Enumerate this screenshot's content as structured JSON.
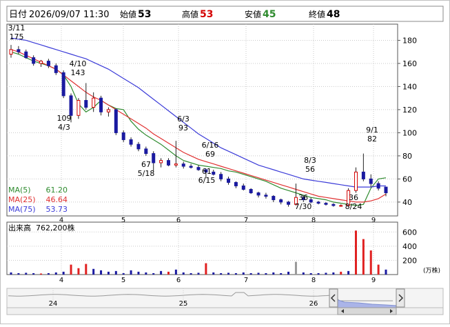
{
  "header": {
    "date_label": "日付",
    "datetime": "2026/09/07 11:30",
    "open_label": "始値",
    "open_value": "53",
    "high_label": "高値",
    "high_value": "53",
    "low_label": "安値",
    "low_value": "45",
    "close_label": "終値",
    "close_value": "48"
  },
  "colors": {
    "up": "#d40000",
    "down": "#1a1aa0",
    "ma5": "#2e8b2e",
    "ma25": "#e03030",
    "ma75": "#3a3ad8",
    "grid": "#c8c8c8",
    "volume_up": "#e02020",
    "volume_down": "#1a1aa0",
    "volume_neutral": "#999999",
    "navigator_fill": "#aab4e8",
    "low_value": "#2e8b2e",
    "high_value": "#d40000"
  },
  "legend": {
    "ma5_label": "MA(5)",
    "ma5_value": "61.20",
    "ma25_label": "MA(25)",
    "ma25_value": "46.64",
    "ma75_label": "MA(75)",
    "ma75_value": "53.73"
  },
  "volume_panel": {
    "label": "出来高",
    "value": "762,200株",
    "unit": "(万株)"
  },
  "navigator": {
    "labels": [
      "24",
      "25",
      "26"
    ],
    "left_handle_icon": "chevron-left-icon",
    "right_handle_icon": "chevron-right-icon",
    "scroll_left_icon": "triangle-left-icon",
    "scroll_right_icon": "triangle-right-icon"
  },
  "chart_data": [
    {
      "type": "candlestick",
      "y_ticks": [
        "40",
        "60",
        "80",
        "100",
        "120",
        "140",
        "160",
        "180"
      ],
      "ylim": [
        28,
        194
      ],
      "x_ticks": [
        "4",
        "5",
        "6",
        "7",
        "8",
        "9"
      ],
      "annotations": [
        {
          "text": "3/11",
          "value": "175"
        },
        {
          "text": "4/10",
          "value": "143"
        },
        {
          "text": "109",
          "value": "4/3"
        },
        {
          "text": "67",
          "value": "5/18"
        },
        {
          "text": "6/3",
          "value": "93"
        },
        {
          "text": "6/16",
          "value": "69"
        },
        {
          "text": "61",
          "value": "6/15"
        },
        {
          "text": "8/3",
          "value": "56"
        },
        {
          "text": "36",
          "value": "7/30"
        },
        {
          "text": "36",
          "value": "8/24"
        },
        {
          "text": "9/1",
          "value": "82"
        }
      ],
      "series": [
        {
          "name": "MA(5)",
          "values": [
            170,
            168,
            165,
            162,
            160,
            158,
            155,
            150,
            140,
            125,
            118,
            122,
            128,
            124,
            121,
            120,
            110,
            103,
            98,
            94,
            90,
            85,
            80,
            76,
            74,
            72,
            71,
            70,
            69,
            67,
            66,
            64,
            62,
            60,
            58,
            55,
            52,
            50,
            48,
            46,
            44,
            43,
            42,
            40,
            39,
            38,
            37,
            38,
            52,
            60,
            61
          ]
        },
        {
          "name": "MA(25)",
          "values": [
            172,
            170,
            167,
            164,
            161,
            158,
            155,
            150,
            145,
            140,
            135,
            131,
            128,
            124,
            120,
            116,
            112,
            108,
            104,
            99,
            95,
            91,
            87,
            83,
            80,
            77,
            75,
            73,
            71,
            69,
            67,
            65,
            63,
            61,
            59,
            57,
            55,
            53,
            51,
            49,
            47,
            45,
            44,
            43,
            42,
            41,
            40,
            40,
            41,
            43,
            47
          ]
        },
        {
          "name": "MA(75)",
          "values": [
            182,
            181,
            180,
            178,
            176,
            174,
            172,
            170,
            168,
            166,
            164,
            161,
            158,
            155,
            151,
            147,
            143,
            139,
            134,
            129,
            124,
            119,
            114,
            109,
            104,
            99,
            95,
            91,
            87,
            84,
            81,
            78,
            75,
            72,
            70,
            68,
            66,
            64,
            62,
            60,
            59,
            58,
            57,
            56,
            55,
            54,
            53,
            53,
            53,
            54,
            54
          ]
        }
      ],
      "candles": [
        {
          "o": 168,
          "h": 176,
          "l": 165,
          "c": 172
        },
        {
          "o": 172,
          "h": 175,
          "l": 168,
          "c": 170
        },
        {
          "o": 170,
          "h": 172,
          "l": 164,
          "c": 165
        },
        {
          "o": 165,
          "h": 167,
          "l": 158,
          "c": 160
        },
        {
          "o": 160,
          "h": 163,
          "l": 157,
          "c": 162
        },
        {
          "o": 162,
          "h": 164,
          "l": 156,
          "c": 158
        },
        {
          "o": 158,
          "h": 160,
          "l": 150,
          "c": 152
        },
        {
          "o": 152,
          "h": 154,
          "l": 130,
          "c": 132
        },
        {
          "o": 132,
          "h": 134,
          "l": 109,
          "c": 115
        },
        {
          "o": 115,
          "h": 130,
          "l": 112,
          "c": 128
        },
        {
          "o": 128,
          "h": 143,
          "l": 120,
          "c": 122
        },
        {
          "o": 122,
          "h": 135,
          "l": 118,
          "c": 130
        },
        {
          "o": 130,
          "h": 132,
          "l": 115,
          "c": 118
        },
        {
          "o": 118,
          "h": 122,
          "l": 114,
          "c": 120
        },
        {
          "o": 120,
          "h": 121,
          "l": 98,
          "c": 100
        },
        {
          "o": 100,
          "h": 102,
          "l": 92,
          "c": 94
        },
        {
          "o": 94,
          "h": 96,
          "l": 88,
          "c": 90
        },
        {
          "o": 90,
          "h": 92,
          "l": 84,
          "c": 86
        },
        {
          "o": 86,
          "h": 88,
          "l": 80,
          "c": 82
        },
        {
          "o": 82,
          "h": 84,
          "l": 67,
          "c": 74
        },
        {
          "o": 74,
          "h": 78,
          "l": 70,
          "c": 76
        },
        {
          "o": 76,
          "h": 78,
          "l": 71,
          "c": 72
        },
        {
          "o": 72,
          "h": 93,
          "l": 70,
          "c": 73
        },
        {
          "o": 73,
          "h": 75,
          "l": 69,
          "c": 71
        },
        {
          "o": 71,
          "h": 73,
          "l": 69,
          "c": 70
        },
        {
          "o": 70,
          "h": 72,
          "l": 67,
          "c": 68
        },
        {
          "o": 68,
          "h": 69,
          "l": 61,
          "c": 66
        },
        {
          "o": 66,
          "h": 68,
          "l": 63,
          "c": 64
        },
        {
          "o": 64,
          "h": 66,
          "l": 58,
          "c": 60
        },
        {
          "o": 60,
          "h": 62,
          "l": 55,
          "c": 57
        },
        {
          "o": 57,
          "h": 58,
          "l": 52,
          "c": 54
        },
        {
          "o": 54,
          "h": 56,
          "l": 50,
          "c": 51
        },
        {
          "o": 51,
          "h": 52,
          "l": 47,
          "c": 48
        },
        {
          "o": 48,
          "h": 49,
          "l": 44,
          "c": 46
        },
        {
          "o": 46,
          "h": 48,
          "l": 43,
          "c": 45
        },
        {
          "o": 45,
          "h": 46,
          "l": 40,
          "c": 42
        },
        {
          "o": 42,
          "h": 43,
          "l": 38,
          "c": 40
        },
        {
          "o": 40,
          "h": 41,
          "l": 36,
          "c": 38
        },
        {
          "o": 38,
          "h": 56,
          "l": 37,
          "c": 44
        },
        {
          "o": 44,
          "h": 46,
          "l": 40,
          "c": 42
        },
        {
          "o": 42,
          "h": 44,
          "l": 39,
          "c": 40
        },
        {
          "o": 40,
          "h": 41,
          "l": 38,
          "c": 39
        },
        {
          "o": 39,
          "h": 40,
          "l": 37,
          "c": 38
        },
        {
          "o": 38,
          "h": 39,
          "l": 36,
          "c": 37
        },
        {
          "o": 37,
          "h": 38,
          "l": 36,
          "c": 37
        },
        {
          "o": 37,
          "h": 52,
          "l": 36,
          "c": 50
        },
        {
          "o": 50,
          "h": 70,
          "l": 48,
          "c": 66
        },
        {
          "o": 66,
          "h": 82,
          "l": 58,
          "c": 60
        },
        {
          "o": 60,
          "h": 64,
          "l": 53,
          "c": 56
        },
        {
          "o": 56,
          "h": 58,
          "l": 50,
          "c": 52
        },
        {
          "o": 53,
          "h": 53,
          "l": 45,
          "c": 48
        }
      ]
    },
    {
      "type": "bar",
      "name": "volume",
      "y_ticks": [
        "200",
        "400",
        "600"
      ],
      "ylim": [
        0,
        700
      ],
      "values": [
        30,
        20,
        25,
        20,
        15,
        20,
        30,
        40,
        140,
        90,
        150,
        80,
        60,
        40,
        50,
        20,
        60,
        40,
        30,
        20,
        50,
        40,
        70,
        30,
        20,
        25,
        160,
        30,
        20,
        25,
        20,
        30,
        20,
        25,
        20,
        30,
        20,
        40,
        180,
        30,
        20,
        20,
        25,
        30,
        40,
        50,
        620,
        500,
        340,
        140,
        70
      ],
      "colors": [
        "down",
        "down",
        "down",
        "down",
        "up",
        "down",
        "down",
        "down",
        "up",
        "up",
        "up",
        "down",
        "down",
        "down",
        "down",
        "down",
        "down",
        "down",
        "down",
        "down",
        "down",
        "up",
        "down",
        "down",
        "down",
        "down",
        "up",
        "down",
        "down",
        "down",
        "down",
        "down",
        "down",
        "down",
        "down",
        "down",
        "down",
        "down",
        "neutral",
        "down",
        "down",
        "down",
        "down",
        "down",
        "up",
        "down",
        "up",
        "up",
        "up",
        "up",
        "down"
      ]
    }
  ]
}
